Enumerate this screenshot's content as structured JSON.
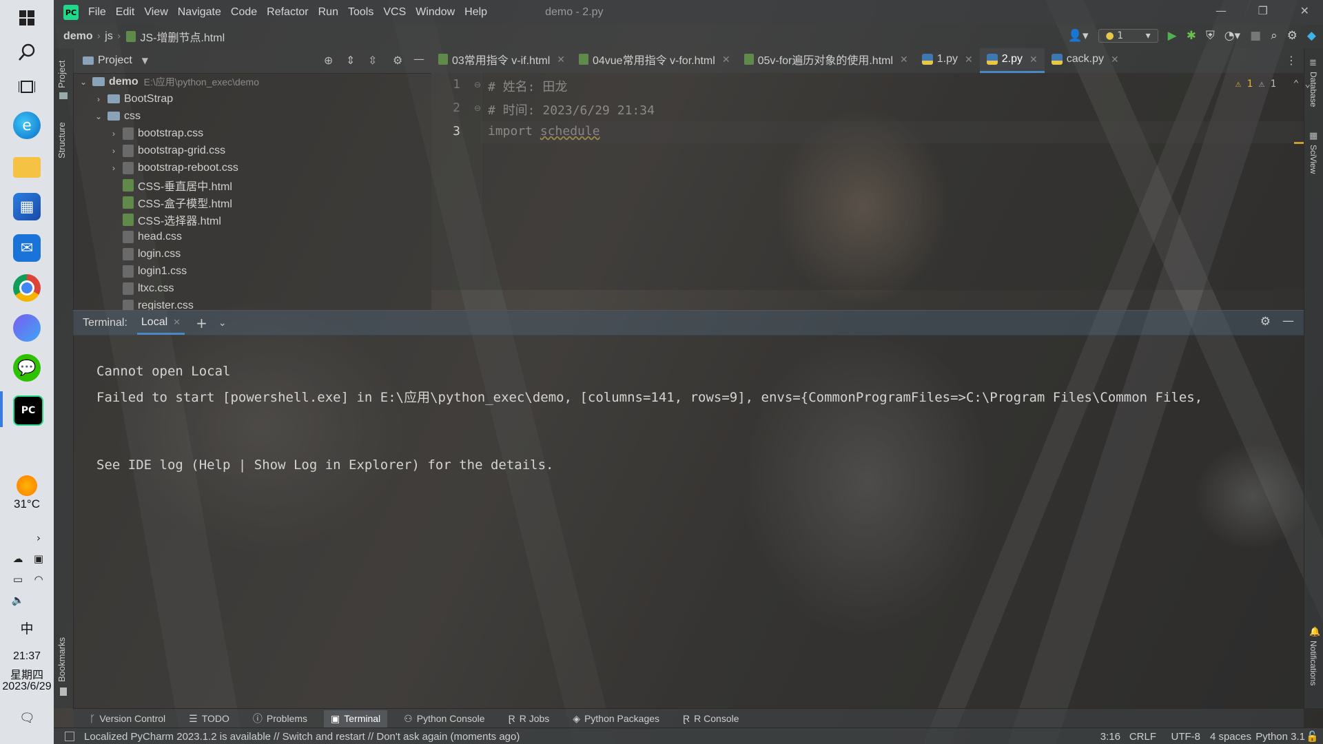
{
  "taskbar": {
    "weather_temp": "31°C",
    "time": "21:37",
    "weekday": "星期四",
    "date": "2023/6/29",
    "ime": "中"
  },
  "menubar": {
    "items": [
      "File",
      "Edit",
      "View",
      "Navigate",
      "Code",
      "Refactor",
      "Run",
      "Tools",
      "VCS",
      "Window",
      "Help"
    ],
    "window_title": "demo - 2.py"
  },
  "navbar": {
    "breadcrumb": [
      "demo",
      "js",
      "JS-增删节点.html"
    ],
    "run_config": "1"
  },
  "left_strip": {
    "project": "Project",
    "structure": "Structure",
    "bookmarks": "Bookmarks"
  },
  "right_strip": {
    "database": "Database",
    "sciview": "SciView",
    "notifications": "Notifications"
  },
  "project": {
    "title": "Project",
    "root_name": "demo",
    "root_path": "E:\\应用\\python_exec\\demo",
    "tree": [
      {
        "name": "BootStrap",
        "kind": "folder",
        "depth": 1,
        "expanded": false
      },
      {
        "name": "css",
        "kind": "folder",
        "depth": 1,
        "expanded": true
      },
      {
        "name": "bootstrap.css",
        "kind": "css",
        "depth": 2,
        "expandable": true
      },
      {
        "name": "bootstrap-grid.css",
        "kind": "css",
        "depth": 2,
        "expandable": true
      },
      {
        "name": "bootstrap-reboot.css",
        "kind": "css",
        "depth": 2,
        "expandable": true
      },
      {
        "name": "CSS-垂直居中.html",
        "kind": "html",
        "depth": 2
      },
      {
        "name": "CSS-盒子模型.html",
        "kind": "html",
        "depth": 2
      },
      {
        "name": "CSS-选择器.html",
        "kind": "html",
        "depth": 2
      },
      {
        "name": "head.css",
        "kind": "css",
        "depth": 2
      },
      {
        "name": "login.css",
        "kind": "css",
        "depth": 2
      },
      {
        "name": "login1.css",
        "kind": "css",
        "depth": 2
      },
      {
        "name": "ltxc.css",
        "kind": "css",
        "depth": 2
      },
      {
        "name": "register.css",
        "kind": "css",
        "depth": 2
      }
    ]
  },
  "editor": {
    "tabs": [
      {
        "label": "03常用指令 v-if.html",
        "kind": "html",
        "active": false
      },
      {
        "label": "04vue常用指令 v-for.html",
        "kind": "html",
        "active": false
      },
      {
        "label": "05v-for遍历对象的使用.html",
        "kind": "html",
        "active": false
      },
      {
        "label": "1.py",
        "kind": "py",
        "active": false
      },
      {
        "label": "2.py",
        "kind": "py",
        "active": true
      },
      {
        "label": "cack.py",
        "kind": "py",
        "active": false
      }
    ],
    "line_numbers": [
      "1",
      "2",
      "3"
    ],
    "lines": [
      {
        "prefix": "# ",
        "text": "姓名: 田龙",
        "type": "comment"
      },
      {
        "prefix": "# ",
        "text": "时间: 2023/6/29 21:34",
        "type": "comment"
      },
      {
        "prefix": "import ",
        "text": "schedule",
        "type": "import"
      }
    ],
    "warnings_a": "1",
    "warnings_b": "1"
  },
  "terminal": {
    "label": "Terminal:",
    "tab": "Local",
    "lines": [
      "Cannot open Local",
      "Failed to start [powershell.exe] in E:\\应用\\python_exec\\demo, [columns=141, rows=9], envs={CommonProgramFiles=>C:\\Program Files\\Common Files,",
      "See IDE log (Help | Show Log in Explorer) for the details."
    ]
  },
  "tool_tabs": [
    "Version Control",
    "TODO",
    "Problems",
    "Terminal",
    "Python Console",
    "R Jobs",
    "Python Packages",
    "R Console"
  ],
  "active_tool_tab": "Terminal",
  "status": {
    "message": "Localized PyCharm 2023.1.2 is available // Switch and restart // Don't ask again (moments ago)",
    "position": "3:16",
    "line_sep": "CRLF",
    "encoding": "UTF-8",
    "indent": "4 spaces",
    "interpreter": "Python 3.1"
  }
}
